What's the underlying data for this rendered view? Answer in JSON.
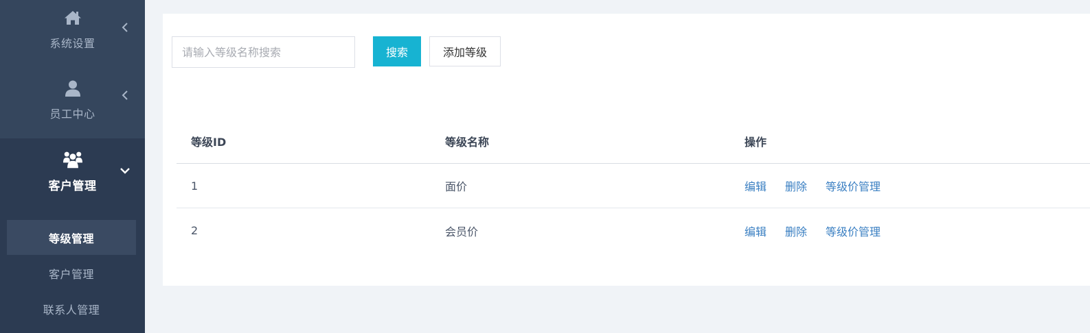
{
  "sidebar": {
    "groups": [
      {
        "label": "系统设置",
        "icon": "home-icon",
        "state": "collapsed"
      },
      {
        "label": "员工中心",
        "icon": "user-icon",
        "state": "collapsed"
      },
      {
        "label": "客户管理",
        "icon": "users-icon",
        "state": "expanded",
        "items": [
          {
            "label": "等级管理",
            "active": true
          },
          {
            "label": "客户管理",
            "active": false
          },
          {
            "label": "联系人管理",
            "active": false
          }
        ]
      }
    ]
  },
  "toolbar": {
    "search_placeholder": "请输入等级名称搜索",
    "search_value": "",
    "search_button": "搜索",
    "add_button": "添加等级"
  },
  "table": {
    "columns": [
      "等级ID",
      "等级名称",
      "操作"
    ],
    "rows": [
      {
        "id": "1",
        "name": "面价",
        "actions": [
          "编辑",
          "删除",
          "等级价管理"
        ]
      },
      {
        "id": "2",
        "name": "会员价",
        "actions": [
          "编辑",
          "删除",
          "等级价管理"
        ]
      }
    ]
  },
  "colors": {
    "sidebar_bg": "#2f4058",
    "accent": "#17b3d2",
    "link": "#3a7fc2"
  }
}
